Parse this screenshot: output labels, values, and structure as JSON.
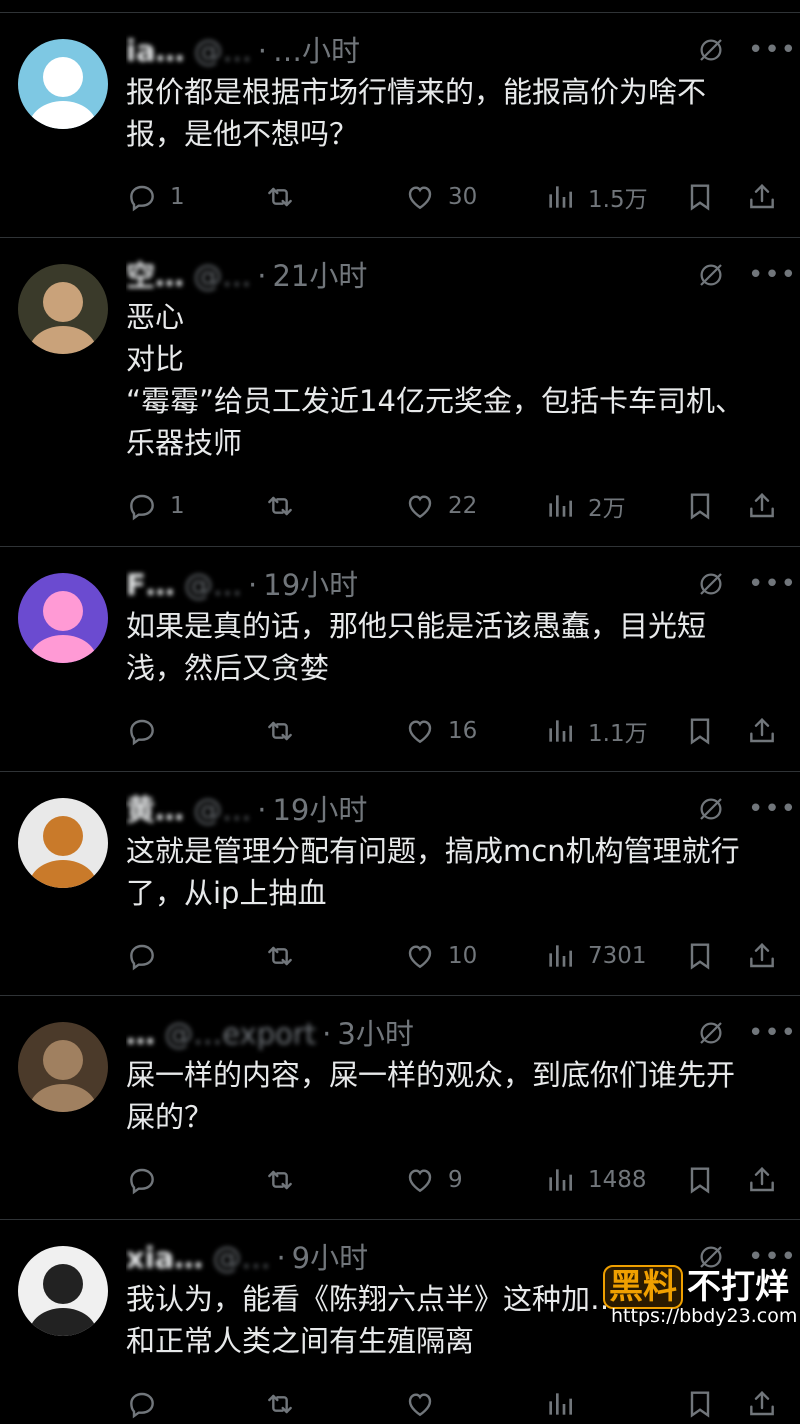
{
  "posts": [
    {
      "name": "ia…",
      "handle": "@…",
      "time": "…小时",
      "lines": [
        "报价都是根据市场行情来的，能报高价为啥不",
        "报，是他不想吗？"
      ],
      "replies": "1",
      "likes": "30",
      "views": "1.5万"
    },
    {
      "name": "空…",
      "handle": "@…",
      "time": "21小时",
      "lines": [
        "恶心",
        "对比",
        "“霉霉”给员工发近14亿元奖金，包括卡车司机、",
        "乐器技师"
      ],
      "replies": "1",
      "likes": "22",
      "views": "2万"
    },
    {
      "name": "F…",
      "handle": "@…",
      "time": "19小时",
      "lines": [
        "如果是真的话，那他只能是活该愚蠢，目光短",
        "浅，然后又贪婪"
      ],
      "replies": "",
      "likes": "16",
      "views": "1.1万"
    },
    {
      "name": "黄…",
      "handle": "@…",
      "time": "19小时",
      "lines": [
        "这就是管理分配有问题，搞成mcn机构管理就行",
        "了，从ip上抽血"
      ],
      "replies": "",
      "likes": "10",
      "views": "7301"
    },
    {
      "name": "…",
      "handle": "@…export",
      "time": "3小时",
      "lines": [
        "屎一样的内容，屎一样的观众，到底你们谁先开",
        "屎的？"
      ],
      "replies": "",
      "likes": "9",
      "views": "1488"
    },
    {
      "name": "xia…",
      "handle": "@…",
      "time": "9小时",
      "lines": [
        "我认为，能看《陈翔六点半》这种加…",
        "和正常人类之间有生殖隔离"
      ],
      "replies": "",
      "likes": "",
      "views": ""
    }
  ],
  "icons": {
    "grok": "grok-icon",
    "more": "more-icon",
    "reply": "reply-icon",
    "repost": "repost-icon",
    "like": "heart-icon",
    "views": "views-icon",
    "bookmark": "bookmark-icon",
    "share": "share-icon"
  },
  "colors": {
    "background": "#000000",
    "text": "#e7e9ea",
    "muted": "#71767b",
    "divider": "#2f3336",
    "watermark_accent": "#f0a000"
  },
  "watermark": {
    "hei": "黑料",
    "bu": "不打烊",
    "url": "https://bbdy23.com"
  }
}
